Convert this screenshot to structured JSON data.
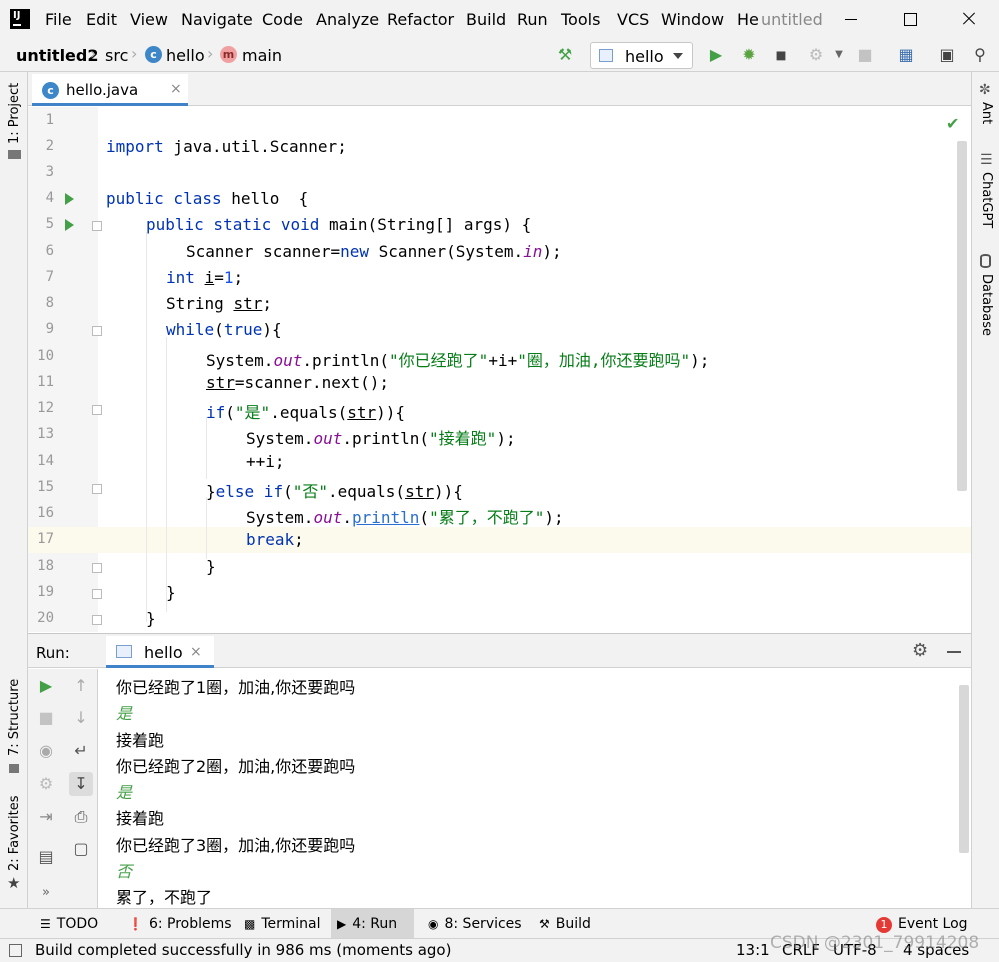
{
  "menubar": {
    "items": [
      "File",
      "Edit",
      "View",
      "Navigate",
      "Code",
      "Analyze",
      "Refactor",
      "Build",
      "Run",
      "Tools",
      "VCS",
      "Window",
      "He"
    ],
    "window_title": "untitled",
    "logo_text": "IJ"
  },
  "navbar": {
    "breadcrumbs": [
      "untitled2",
      "src",
      "hello",
      "main"
    ],
    "run_config": "hello"
  },
  "left_strip": {
    "project": "1: Project",
    "structure": "7: Structure",
    "favorites": "2: Favorites"
  },
  "right_strip": {
    "ant": "Ant",
    "chatgpt": "ChatGPT",
    "database": "Database"
  },
  "editor": {
    "tab_label": "hello.java",
    "tab_close": "×",
    "line_numbers": [
      "1",
      "2",
      "3",
      "4",
      "5",
      "6",
      "7",
      "8",
      "9",
      "10",
      "11",
      "12",
      "13",
      "14",
      "15",
      "16",
      "17",
      "18",
      "19",
      "20"
    ],
    "code": {
      "l2_kw": "import",
      "l2_rest": " java.util.Scanner;",
      "l4_kw": "public class",
      "l4_rest": " hello  {",
      "l5_kw": "public static void",
      "l5_rest": " main(String[] args) {",
      "l6_a": "Scanner scanner=",
      "l6_kw": "new",
      "l6_b": " Scanner(System.",
      "l6_fld": "in",
      "l6_c": ");",
      "l7_kw": "int",
      "l7_sp": " ",
      "l7_var": "i",
      "l7_eq": "=",
      "l7_num": "1",
      "l7_end": ";",
      "l8_a": "String ",
      "l8_var": "str",
      "l8_end": ";",
      "l9_kw": "while",
      "l9_a": "(",
      "l9_kw2": "true",
      "l9_b": "){",
      "l10_a": "System.",
      "l10_fld": "out",
      "l10_b": ".println(",
      "l10_s1": "\"你已经跑了\"",
      "l10_c": "+i+",
      "l10_s2": "\"圈，加油,你还要跑吗\"",
      "l10_d": ");",
      "l11_var": "str",
      "l11_rest": "=scanner.next();",
      "l12_kw": "if",
      "l12_a": "(",
      "l12_s": "\"是\"",
      "l12_b": ".equals(",
      "l12_var": "str",
      "l12_c": ")){",
      "l13_a": "System.",
      "l13_fld": "out",
      "l13_b": ".println(",
      "l13_s": "\"接着跑\"",
      "l13_c": ");",
      "l14": "++i;",
      "l15_a": "}",
      "l15_kw": "else if",
      "l15_b": "(",
      "l15_s": "\"否\"",
      "l15_c": ".equals(",
      "l15_var": "str",
      "l15_d": ")){",
      "l16_a": "System.",
      "l16_fld": "out",
      "l16_b": ".",
      "l16_link": "println",
      "l16_c": "(",
      "l16_s": "\"累了，不跑了\"",
      "l16_d": ");",
      "l17_kw": "break",
      "l17_end": ";",
      "l18": "}",
      "l19": "}",
      "l20": "}"
    }
  },
  "run_panel": {
    "label": "Run:",
    "tab_label": "hello",
    "tab_close": "×",
    "console_lines": [
      {
        "text": "你已经跑了1圈，加油,你还要跑吗",
        "input": false
      },
      {
        "text": "是",
        "input": true
      },
      {
        "text": "接着跑",
        "input": false
      },
      {
        "text": "你已经跑了2圈，加油,你还要跑吗",
        "input": false
      },
      {
        "text": "是",
        "input": true
      },
      {
        "text": "接着跑",
        "input": false
      },
      {
        "text": "你已经跑了3圈，加油,你还要跑吗",
        "input": false
      },
      {
        "text": "否",
        "input": true
      },
      {
        "text": "累了，不跑了",
        "input": false
      }
    ]
  },
  "bottom_tools": {
    "todo": "TODO",
    "problems": "6: Problems",
    "terminal": "Terminal",
    "run": "4: Run",
    "services": "8: Services",
    "build": "Build",
    "event_log": "Event Log",
    "event_count": "1"
  },
  "status": {
    "message": "Build completed successfully in 986 ms (moments ago)",
    "position": "13:1",
    "line_sep": "CRLF",
    "encoding": "UTF-8",
    "indent": "4 spaces",
    "watermark": "CSDN @2301_79914208"
  },
  "colors": {
    "keyword": "#0033b3",
    "string": "#067d17",
    "number": "#1750eb",
    "field": "#871094",
    "run_green": "#43a047",
    "tab_underline": "#4083c9"
  }
}
